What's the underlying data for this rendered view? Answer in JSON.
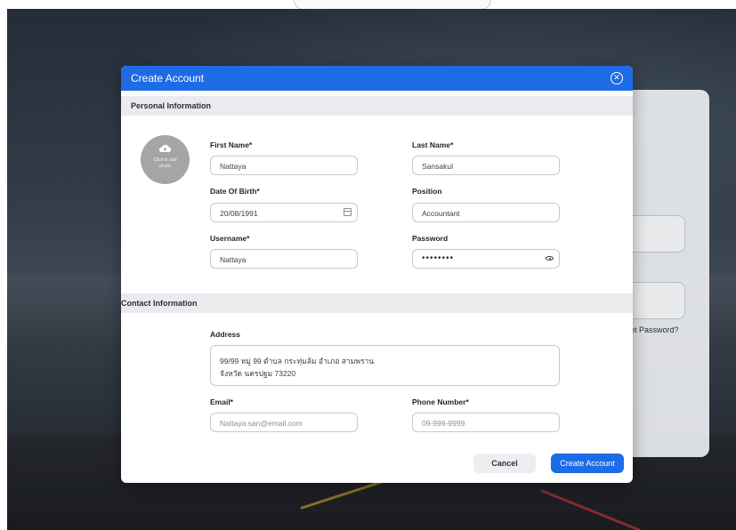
{
  "background": {
    "login_card": {
      "forgot_password_text": "et Password?",
      "partial_text": "t"
    }
  },
  "modal": {
    "title": "Create Account",
    "close_icon": "close-circle-icon",
    "personal_section": {
      "title": "Personal Information",
      "avatar": {
        "icon": "cloud-upload-icon",
        "line1": "Click to add",
        "line2": "photo"
      },
      "first_name": {
        "label": "First Name*",
        "value": "Nattaya"
      },
      "last_name": {
        "label": "Last Name*",
        "value": "Sansakul"
      },
      "dob": {
        "label": "Date Of Birth*",
        "value": "20/08/1991",
        "icon": "calendar-icon"
      },
      "position": {
        "label": "Position",
        "value": "Accountant"
      },
      "username": {
        "label": "Username*",
        "value": "Nattaya"
      },
      "password": {
        "label": "Password",
        "masked": "••••••••",
        "icon": "eye-icon"
      }
    },
    "contact_section": {
      "title": "Contact Information",
      "address": {
        "label": "Address",
        "line1": "99/99 หมู่ 99 ตำบล กระทุ่มล้ม อำเภอ สามพราน",
        "line2": "จังหวัด นครปฐม 73220"
      },
      "email": {
        "label": "Email*",
        "value": "Nattaya.san@email.com"
      },
      "phone": {
        "label": "Phone Number*",
        "value": "09-999-9999"
      }
    },
    "buttons": {
      "cancel": "Cancel",
      "create": "Create Account"
    }
  },
  "colors": {
    "primary": "#1e6be6",
    "section_bg": "#e9ebee",
    "avatar_bg": "#a5a5a5"
  }
}
